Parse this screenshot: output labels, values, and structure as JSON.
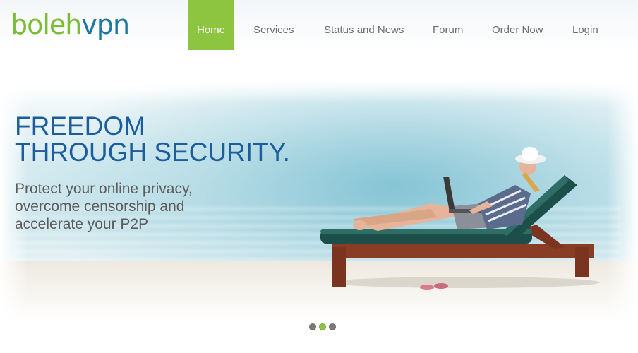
{
  "brand": {
    "logo_part1": "boleh",
    "logo_part2": "vpn"
  },
  "nav": {
    "items": [
      {
        "label": "Home",
        "active": true
      },
      {
        "label": "Services",
        "active": false
      },
      {
        "label": "Status and News",
        "active": false
      },
      {
        "label": "Forum",
        "active": false
      },
      {
        "label": "Order Now",
        "active": false
      },
      {
        "label": "Login",
        "active": false
      }
    ]
  },
  "hero": {
    "headline_line1": "FREEDOM",
    "headline_line2": "THROUGH SECURITY.",
    "sub_line1": "Protect your online privacy,",
    "sub_line2": "overcome censorship and",
    "sub_line3": "accelerate your P2P"
  },
  "slider": {
    "slide_count": 3,
    "active_index": 1
  },
  "colors": {
    "accent_green": "#8dc540",
    "brand_blue": "#1e77a5",
    "headline_blue": "#1c5e9c",
    "nav_text": "#6d6d6d"
  },
  "icons": [
    "slide-dot-icon"
  ]
}
